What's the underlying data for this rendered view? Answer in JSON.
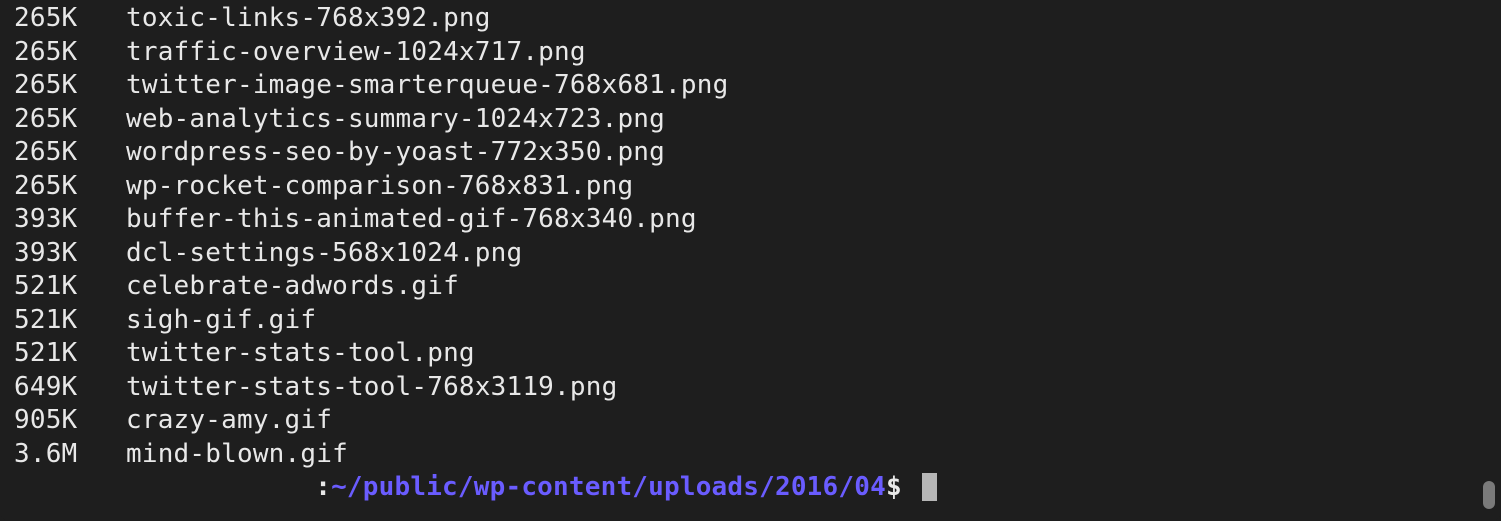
{
  "files": [
    {
      "size": "265K",
      "name": "toxic-links-768x392.png"
    },
    {
      "size": "265K",
      "name": "traffic-overview-1024x717.png"
    },
    {
      "size": "265K",
      "name": "twitter-image-smarterqueue-768x681.png"
    },
    {
      "size": "265K",
      "name": "web-analytics-summary-1024x723.png"
    },
    {
      "size": "265K",
      "name": "wordpress-seo-by-yoast-772x350.png"
    },
    {
      "size": "265K",
      "name": "wp-rocket-comparison-768x831.png"
    },
    {
      "size": "393K",
      "name": "buffer-this-animated-gif-768x340.png"
    },
    {
      "size": "393K",
      "name": "dcl-settings-568x1024.png"
    },
    {
      "size": "521K",
      "name": "celebrate-adwords.gif"
    },
    {
      "size": "521K",
      "name": "sigh-gif.gif"
    },
    {
      "size": "521K",
      "name": "twitter-stats-tool.png"
    },
    {
      "size": "649K",
      "name": "twitter-stats-tool-768x3119.png"
    },
    {
      "size": "905K",
      "name": "crazy-amy.gif"
    },
    {
      "size": "3.6M",
      "name": "mind-blown.gif"
    }
  ],
  "prompt": {
    "indent": "                   ",
    "colon": ":",
    "path": "~/public/wp-content/uploads/2016/04",
    "dollar": "$ "
  }
}
